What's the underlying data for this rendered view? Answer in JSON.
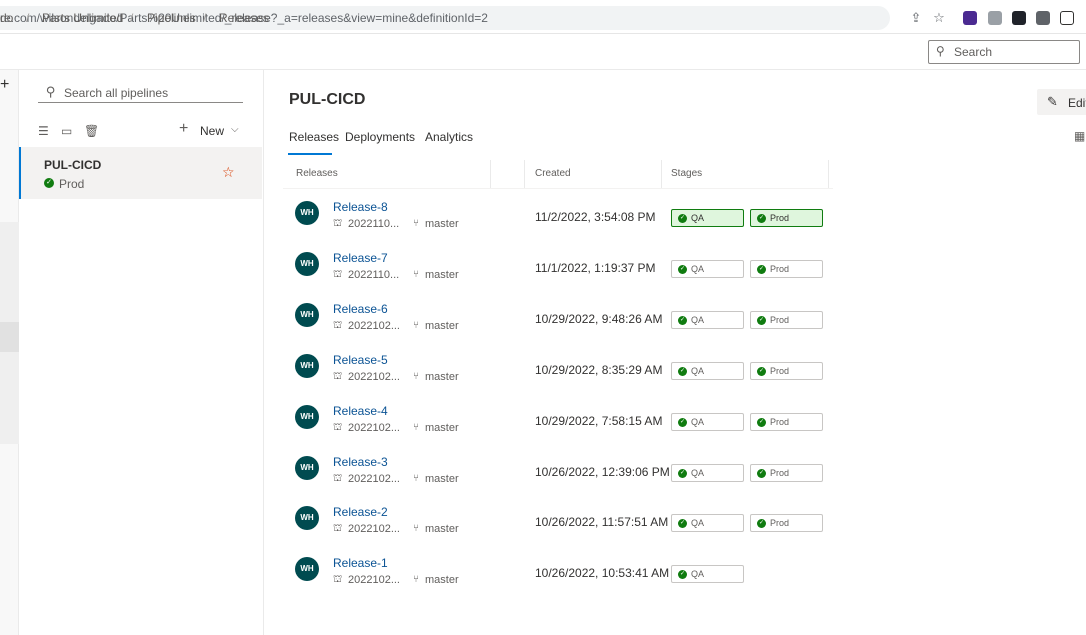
{
  "browser": {
    "url": "re.com/wilsondelgado/Parts%20Unlimited/_release?_a=releases&view=mine&definitionId=2"
  },
  "breadcrumb": {
    "items": [
      "do",
      "Parts Unlimited",
      "Pipelines",
      "Releases"
    ],
    "separator": "/"
  },
  "top_search": {
    "placeholder": "Search"
  },
  "sidebar": {
    "search_placeholder": "Search all pipelines",
    "new_label": "New",
    "pipeline": {
      "name": "PUL-CICD",
      "status": "Prod"
    }
  },
  "main": {
    "title": "PUL-CICD",
    "edit_label": "Edit",
    "tabs": [
      "Releases",
      "Deployments",
      "Analytics"
    ],
    "active_tab": "Releases",
    "columns": {
      "releases": "Releases",
      "created": "Created",
      "stages": "Stages"
    },
    "releases": [
      {
        "initials": "WH",
        "name": "Release-8",
        "build": "2022110...",
        "branch": "master",
        "created": "11/2/2022, 3:54:08 PM",
        "stages": [
          {
            "label": "QA",
            "active": true
          },
          {
            "label": "Prod",
            "active": true
          }
        ]
      },
      {
        "initials": "WH",
        "name": "Release-7",
        "build": "2022110...",
        "branch": "master",
        "created": "11/1/2022, 1:19:37 PM",
        "stages": [
          {
            "label": "QA",
            "active": false
          },
          {
            "label": "Prod",
            "active": false
          }
        ]
      },
      {
        "initials": "WH",
        "name": "Release-6",
        "build": "2022102...",
        "branch": "master",
        "created": "10/29/2022, 9:48:26 AM",
        "stages": [
          {
            "label": "QA",
            "active": false
          },
          {
            "label": "Prod",
            "active": false
          }
        ]
      },
      {
        "initials": "WH",
        "name": "Release-5",
        "build": "2022102...",
        "branch": "master",
        "created": "10/29/2022, 8:35:29 AM",
        "stages": [
          {
            "label": "QA",
            "active": false
          },
          {
            "label": "Prod",
            "active": false
          }
        ]
      },
      {
        "initials": "WH",
        "name": "Release-4",
        "build": "2022102...",
        "branch": "master",
        "created": "10/29/2022, 7:58:15 AM",
        "stages": [
          {
            "label": "QA",
            "active": false
          },
          {
            "label": "Prod",
            "active": false
          }
        ]
      },
      {
        "initials": "WH",
        "name": "Release-3",
        "build": "2022102...",
        "branch": "master",
        "created": "10/26/2022, 12:39:06 PM",
        "stages": [
          {
            "label": "QA",
            "active": false
          },
          {
            "label": "Prod",
            "active": false
          }
        ]
      },
      {
        "initials": "WH",
        "name": "Release-2",
        "build": "2022102...",
        "branch": "master",
        "created": "10/26/2022, 11:57:51 AM",
        "stages": [
          {
            "label": "QA",
            "active": false
          },
          {
            "label": "Prod",
            "active": false
          }
        ]
      },
      {
        "initials": "WH",
        "name": "Release-1",
        "build": "2022102...",
        "branch": "master",
        "created": "10/26/2022, 10:53:41 AM",
        "stages": [
          {
            "label": "QA",
            "active": false
          }
        ]
      }
    ]
  },
  "colors": {
    "accent": "#0078d4",
    "success": "#107c10",
    "avatar": "#004b50",
    "link": "#0b5394"
  }
}
